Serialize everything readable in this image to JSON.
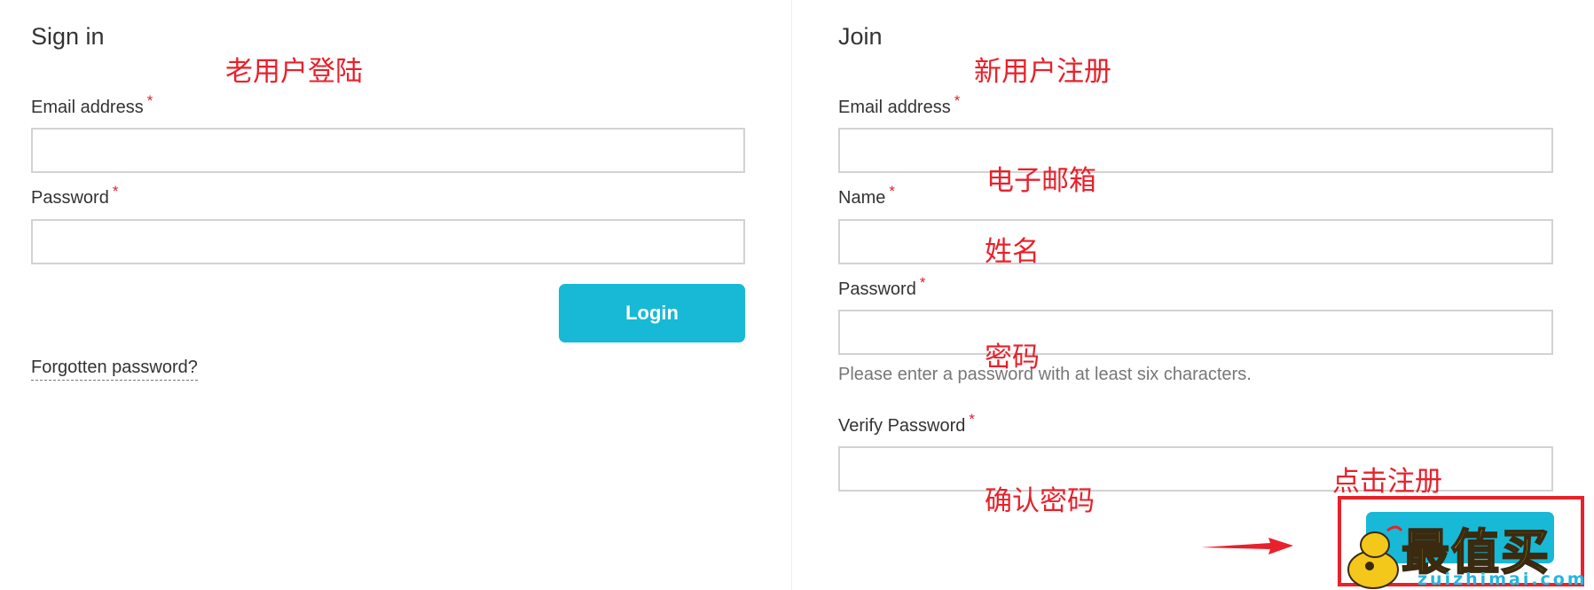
{
  "signin": {
    "title": "Sign in",
    "email_label": "Email address",
    "password_label": "Password",
    "required_mark": "*",
    "login_label": "Login",
    "forgot_label": "Forgotten password?"
  },
  "join": {
    "title": "Join",
    "email_label": "Email address",
    "name_label": "Name",
    "password_label": "Password",
    "password_hint": "Please enter a password with at least six characters.",
    "verify_label": "Verify Password",
    "required_mark": "*"
  },
  "annotations": {
    "old_user_login": "老用户登陆",
    "new_user_register": "新用户注册",
    "email": "电子邮箱",
    "name": "姓名",
    "password": "密码",
    "confirm_password": "确认密码",
    "click_register": "点击注册"
  },
  "watermark": {
    "logo_text": "最值买",
    "site": "zuizhimai.com"
  },
  "colors": {
    "accent": "#17b9d6",
    "annotation_red": "#e8212b",
    "required_red": "#e0202a",
    "border": "#d2d2d2"
  }
}
